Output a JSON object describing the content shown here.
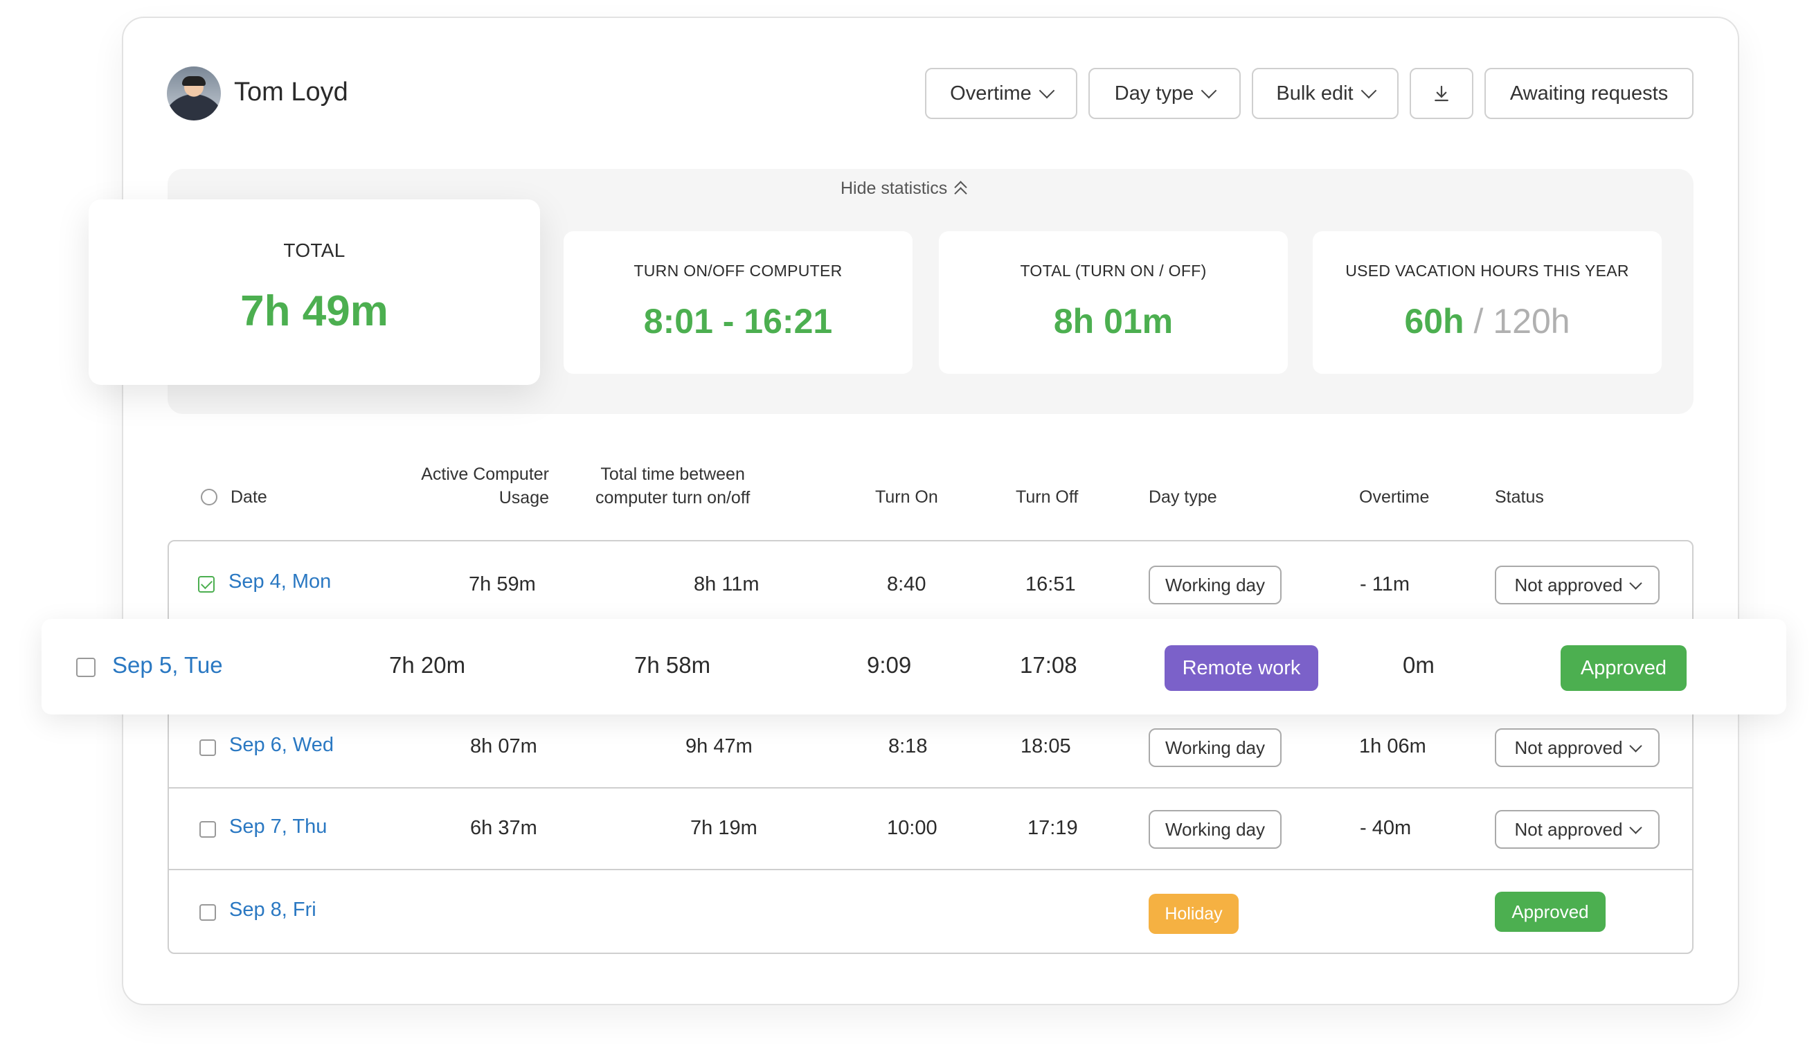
{
  "user": {
    "name": "Tom Loyd"
  },
  "toolbar": {
    "overtime": "Overtime",
    "day_type": "Day type",
    "bulk_edit": "Bulk edit",
    "awaiting": "Awaiting requests"
  },
  "stats": {
    "hide_label": "Hide statistics",
    "total": {
      "label": "TOTAL",
      "value": "7h 49m"
    },
    "turn": {
      "label": "TURN ON/OFF COMPUTER",
      "value": "8:01 - 16:21"
    },
    "total_turn": {
      "label": "TOTAL (TURN ON / OFF)",
      "value": "8h 01m"
    },
    "vacation": {
      "label": "USED VACATION HOURS THIS YEAR",
      "used": "60h",
      "sep": "/",
      "total": "120h"
    }
  },
  "table": {
    "headers": {
      "date": "Date",
      "active_1": "Active Computer",
      "active_2": "Usage",
      "between_1": "Total time between",
      "between_2": "computer turn on/off",
      "turn_on": "Turn On",
      "turn_off": "Turn Off",
      "day_type": "Day type",
      "overtime": "Overtime",
      "status": "Status"
    },
    "rows": [
      {
        "date": "Sep 4, Mon",
        "active": "7h 59m",
        "between": "8h 11m",
        "on": "8:40",
        "off": "16:51",
        "day_type": "Working day",
        "overtime": "- 11m",
        "status": "Not approved",
        "checked": true
      },
      {
        "date": "Sep 5, Tue",
        "active": "7h 20m",
        "between": "7h 58m",
        "on": "9:09",
        "off": "17:08",
        "day_type": "Remote work",
        "overtime": "0m",
        "status": "Approved"
      },
      {
        "date": "Sep 6, Wed",
        "active": "8h 07m",
        "between": "9h 47m",
        "on": "8:18",
        "off": "18:05",
        "day_type": "Working day",
        "overtime": "1h 06m",
        "status": "Not approved"
      },
      {
        "date": "Sep 7, Thu",
        "active": "6h 37m",
        "between": "7h 19m",
        "on": "10:00",
        "off": "17:19",
        "day_type": "Working day",
        "overtime": "- 40m",
        "status": "Not approved"
      },
      {
        "date": "Sep 8, Fri",
        "day_type": "Holiday",
        "status": "Approved"
      }
    ]
  },
  "colors": {
    "green": "#4caf50",
    "purple": "#7b61c9",
    "orange": "#f5b142",
    "link": "#2a78c2"
  },
  "icons": {
    "download": "download-icon",
    "dropdown": "chevron-down-icon",
    "collapse": "chevron-double-up-icon"
  }
}
